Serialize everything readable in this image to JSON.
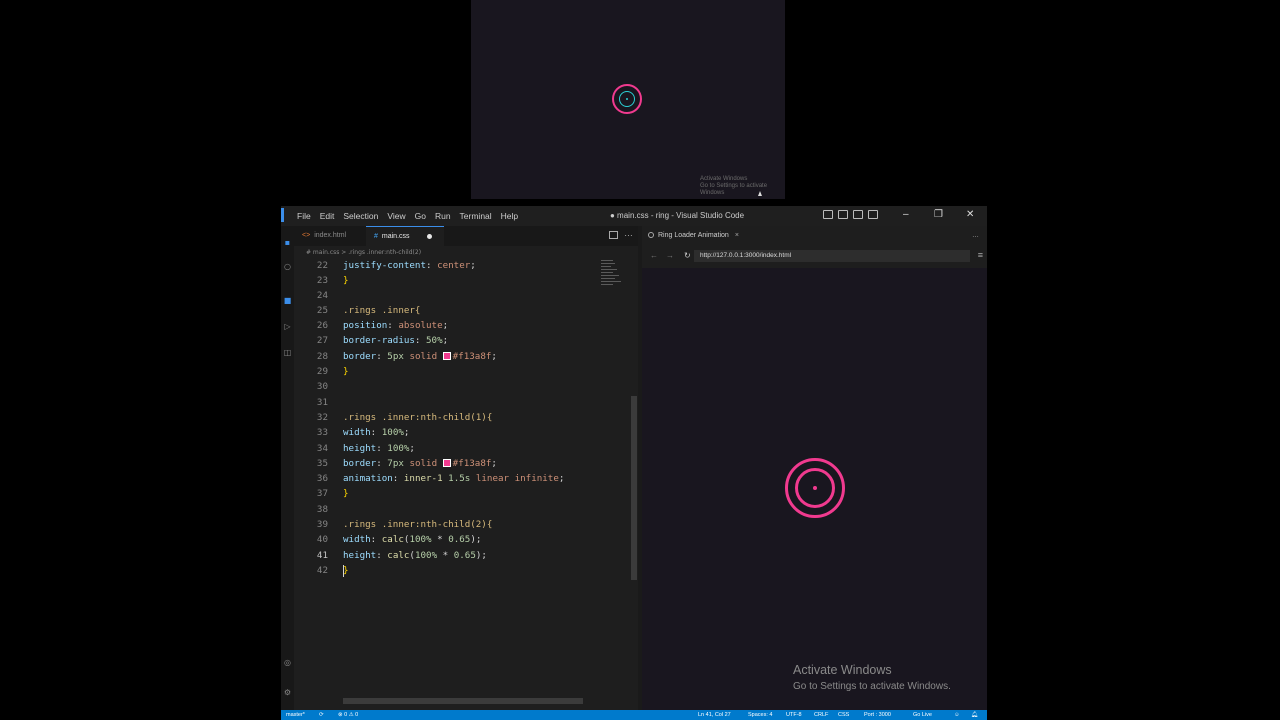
{
  "preview": {
    "activate_line1": "Activate Windows",
    "activate_line2": "Go to Settings to activate Windows"
  },
  "window": {
    "title": "● main.css - ring - Visual Studio Code",
    "menu": [
      "File",
      "Edit",
      "Selection",
      "View",
      "Go",
      "Run",
      "Terminal",
      "Help"
    ]
  },
  "tabs": [
    {
      "label": "index.html",
      "icon": "<>"
    },
    {
      "label": "main.css",
      "icon": "#",
      "active": true,
      "modified": true
    }
  ],
  "breadcrumb": "# main.css > .rings .inner:nth-child(2)",
  "editor": {
    "current_line": 41,
    "lines": [
      {
        "n": 22,
        "text": "justify-content: center;"
      },
      {
        "n": 23,
        "text": "}"
      },
      {
        "n": 24,
        "text": ""
      },
      {
        "n": 25,
        "text": ".rings .inner{"
      },
      {
        "n": 26,
        "text": "position: absolute;"
      },
      {
        "n": 27,
        "text": "border-radius: 50%;"
      },
      {
        "n": 28,
        "text": "border: 5px solid #f13a8f;"
      },
      {
        "n": 29,
        "text": "}"
      },
      {
        "n": 30,
        "text": ""
      },
      {
        "n": 31,
        "text": ""
      },
      {
        "n": 32,
        "text": ".rings .inner:nth-child(1){"
      },
      {
        "n": 33,
        "text": "width: 100%;"
      },
      {
        "n": 34,
        "text": "height: 100%;"
      },
      {
        "n": 35,
        "text": "border: 7px solid #f13a8f;"
      },
      {
        "n": 36,
        "text": "animation: inner-1 1.5s linear infinite;"
      },
      {
        "n": 37,
        "text": "}"
      },
      {
        "n": 38,
        "text": ""
      },
      {
        "n": 39,
        "text": ".rings .inner:nth-child(2){"
      },
      {
        "n": 40,
        "text": "width: calc(100% * 0.65);"
      },
      {
        "n": 41,
        "text": "height: calc(100% * 0.65);"
      },
      {
        "n": 42,
        "text": "}"
      }
    ]
  },
  "browser": {
    "tab_label": "Ring Loader Animation",
    "url": "http://127.0.0.1:3000/index.html",
    "activate_title": "Activate Windows",
    "activate_sub": "Go to Settings to activate Windows."
  },
  "status": {
    "branch": "master*",
    "problems": "⊗ 0 ⚠ 0",
    "position": "Ln 41, Col 27",
    "spaces": "Spaces: 4",
    "encoding": "UTF-8",
    "eol": "CRLF",
    "language": "CSS",
    "port": "Port : 3000",
    "golive": "Go Live"
  },
  "colors": {
    "accent": "#f13a8f",
    "statusbar": "#007acc"
  }
}
